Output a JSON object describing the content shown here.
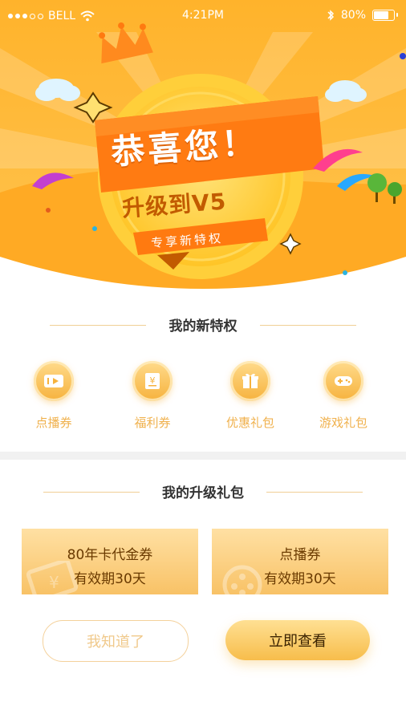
{
  "status_bar": {
    "carrier": "BELL",
    "time": "4:21PM",
    "battery": "80%"
  },
  "banner": {
    "headline": "恭喜您！",
    "level_text": "升级到V5",
    "ribbon_text": "专享新特权"
  },
  "privileges_section": {
    "title": "我的新特权",
    "items": [
      {
        "label": "点播券",
        "icon": "play-ticket-icon"
      },
      {
        "label": "福利券",
        "icon": "yen-ticket-icon"
      },
      {
        "label": "优惠礼包",
        "icon": "gift-icon"
      },
      {
        "label": "游戏礼包",
        "icon": "gamepad-icon"
      }
    ]
  },
  "upgrade_section": {
    "title": "我的升级礼包",
    "coupons": [
      {
        "title": "80年卡代金券",
        "validity": "有效期30天"
      },
      {
        "title": "点播券",
        "validity": "有效期30天"
      }
    ]
  },
  "actions": {
    "secondary_label": "我知道了",
    "primary_label": "立即查看"
  },
  "colors": {
    "accent": "#f7bd4b",
    "hero_bg": "#ffb12e"
  }
}
